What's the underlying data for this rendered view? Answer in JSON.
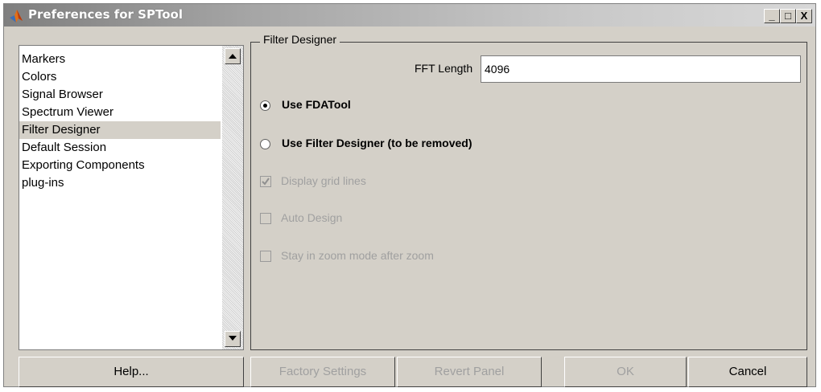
{
  "window": {
    "title": "Preferences for SPTool",
    "controls": [
      "_",
      "□",
      "X"
    ]
  },
  "list": {
    "items": [
      "Markers",
      "Colors",
      "Signal Browser",
      "Spectrum Viewer",
      "Filter Designer",
      "Default Session",
      "Exporting Components",
      "plug-ins"
    ],
    "selected": "Filter Designer"
  },
  "panel": {
    "title": "Filter Designer",
    "fft_length_label": "FFT Length",
    "fft_length_value": "4096",
    "radio_fdatool": "Use FDATool",
    "radio_fdatool_selected": true,
    "radio_filterdesigner": "Use Filter Designer (to be removed)",
    "radio_filterdesigner_selected": false,
    "check_grid": "Display grid lines",
    "check_grid_checked": true,
    "check_auto": "Auto Design",
    "check_auto_checked": false,
    "check_zoom": "Stay in zoom mode after zoom",
    "check_zoom_checked": false
  },
  "buttons": {
    "help": "Help...",
    "factory": "Factory Settings",
    "revert": "Revert Panel",
    "ok": "OK",
    "cancel": "Cancel"
  },
  "colors": {
    "face": "#d4d0c8",
    "disabled_text": "#a0a0a0"
  }
}
